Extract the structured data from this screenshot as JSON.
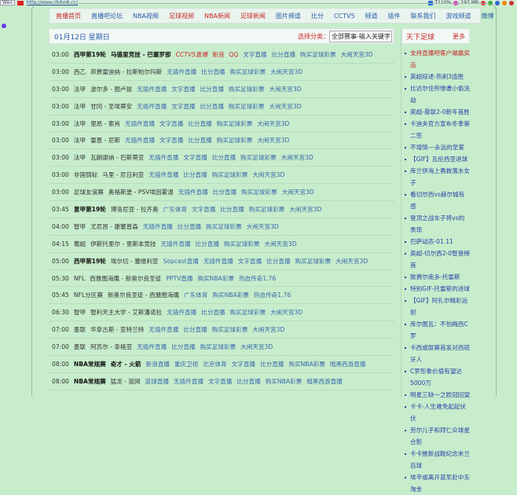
{
  "browser": {
    "favicon_label": "Weo",
    "url": "http://www.zhibo8.cc/",
    "zoom": "T110%",
    "memory": "197 MB"
  },
  "nav": [
    {
      "label": "直播首页",
      "red": true
    },
    {
      "label": "直播吧论坛"
    },
    {
      "label": "NBA视频"
    },
    {
      "label": "足球视频",
      "red": true
    },
    {
      "label": "NBA新闻",
      "red": true
    },
    {
      "label": "足球新闻",
      "red": true
    },
    {
      "label": "图片频道"
    },
    {
      "label": "比分"
    },
    {
      "label": "CCTV5"
    },
    {
      "label": "频道"
    },
    {
      "label": "插件"
    },
    {
      "label": "联系我们"
    },
    {
      "label": "游戏频道"
    },
    {
      "label": "微博"
    }
  ],
  "date_bar": {
    "date": "01月12日 星期日",
    "filter_label": "选择分类：",
    "filter_value": "全部赛事-输入关键字"
  },
  "matches": [
    {
      "time": "03:00",
      "league": "西甲第19轮",
      "bold": true,
      "teams": "马德里竞技 - 巴塞罗那",
      "links": [
        {
          "label": "CCTV5直播",
          "red": true,
          "italic": true
        },
        {
          "label": "新浪",
          "red": true
        },
        {
          "label": "QQ",
          "red": true
        },
        {
          "label": "文字直播"
        },
        {
          "label": "比分直播"
        },
        {
          "label": "购买足球彩票"
        },
        {
          "label": "大闹天宫3D"
        }
      ]
    },
    {
      "time": "03:00",
      "league": "西乙",
      "teams": "邦费雷迪纳 - 拉斯帕尔玛斯",
      "links": [
        {
          "label": "无插件直播"
        },
        {
          "label": "比分直播"
        },
        {
          "label": "购买足球彩票"
        },
        {
          "label": "大闹天宫3D"
        }
      ]
    },
    {
      "time": "03:00",
      "league": "法甲",
      "teams": "波尔多 - 图卢兹",
      "links": [
        {
          "label": "无插件直播"
        },
        {
          "label": "文字直播"
        },
        {
          "label": "比分直播"
        },
        {
          "label": "购买足球彩票"
        },
        {
          "label": "大闹天宫3D"
        }
      ]
    },
    {
      "time": "03:00",
      "league": "法甲",
      "teams": "甘冈 - 圣埃蒂安",
      "links": [
        {
          "label": "无插件直播"
        },
        {
          "label": "文字直播"
        },
        {
          "label": "比分直播"
        },
        {
          "label": "购买足球彩票"
        },
        {
          "label": "大闹天宫3D"
        }
      ]
    },
    {
      "time": "03:00",
      "league": "法甲",
      "teams": "里昂 - 索肖",
      "links": [
        {
          "label": "无插件直播"
        },
        {
          "label": "文字直播"
        },
        {
          "label": "比分直播"
        },
        {
          "label": "购买足球彩票"
        },
        {
          "label": "大闹天宫3D"
        }
      ]
    },
    {
      "time": "03:00",
      "league": "法甲",
      "teams": "雷恩 - 尼斯",
      "links": [
        {
          "label": "无插件直播"
        },
        {
          "label": "文字直播"
        },
        {
          "label": "比分直播"
        },
        {
          "label": "购买足球彩票"
        },
        {
          "label": "大闹天宫3D"
        }
      ]
    },
    {
      "time": "03:00",
      "league": "法甲",
      "teams": "瓦朗谢纳 - 巴斯蒂亚",
      "links": [
        {
          "label": "无插件直播"
        },
        {
          "label": "文字直播"
        },
        {
          "label": "比分直播"
        },
        {
          "label": "购买足球彩票"
        },
        {
          "label": "大闹天宫3D"
        }
      ]
    },
    {
      "time": "03:00",
      "league": "非国锦标",
      "teams": "马里 - 尼日利亚",
      "links": [
        {
          "label": "无插件直播"
        },
        {
          "label": "比分直播"
        },
        {
          "label": "购买足球彩票"
        },
        {
          "label": "大闹天宫3D"
        }
      ]
    },
    {
      "time": "03:00",
      "league": "足球友谊赛",
      "teams": "奥格斯堡 - PSV埃因霍温",
      "links": [
        {
          "label": "无插件直播"
        },
        {
          "label": "比分直播"
        },
        {
          "label": "购买足球彩票"
        },
        {
          "label": "大闹天宫3D"
        }
      ]
    },
    {
      "time": "03:45",
      "league": "意甲第19轮",
      "bold": true,
      "teams": "博洛尼亚 - 拉齐奥",
      "links": [
        {
          "label": "广东体育"
        },
        {
          "label": "文字直播"
        },
        {
          "label": "比分直播"
        },
        {
          "label": "购买足球彩票"
        },
        {
          "label": "大闹天宫3D"
        }
      ]
    },
    {
      "time": "04:00",
      "league": "智甲",
      "teams": "尤尼昂 - 康塞普森",
      "links": [
        {
          "label": "无插件直播"
        },
        {
          "label": "比分直播"
        },
        {
          "label": "购买足球彩票"
        },
        {
          "label": "大闹天宫3D"
        }
      ]
    },
    {
      "time": "04:15",
      "league": "葡超",
      "teams": "伊斯托里尔 - 里斯本竞技",
      "links": [
        {
          "label": "无插件直播"
        },
        {
          "label": "比分直播"
        },
        {
          "label": "购买足球彩票"
        },
        {
          "label": "大闹天宫3D"
        }
      ]
    },
    {
      "time": "05:00",
      "league": "西甲第19轮",
      "bold": true,
      "teams": "埃尔切 - 塞维利亚",
      "links": [
        {
          "label": "Sopcast直播"
        },
        {
          "label": "无插件直播"
        },
        {
          "label": "文字直播"
        },
        {
          "label": "比分直播"
        },
        {
          "label": "购买足球彩票"
        },
        {
          "label": "大闹天宫3D"
        }
      ]
    },
    {
      "time": "05:30",
      "league": "NFL",
      "teams": "西雅图海鹰 - 新奥尔良圣徒",
      "links": [
        {
          "label": "PPTV直播"
        },
        {
          "label": "购买NBA彩票"
        },
        {
          "label": "热血传奇1.76"
        }
      ]
    },
    {
      "time": "05:45",
      "league": "NFL分区赛",
      "teams": "新奥尔良圣徒 - 西雅图海鹰",
      "links": [
        {
          "label": "广东体育"
        },
        {
          "label": "购买NBA彩票"
        },
        {
          "label": "热血传奇1.76"
        }
      ]
    },
    {
      "time": "06:30",
      "league": "智甲",
      "teams": "智利天主大学 - 艾斯潘诺拉",
      "links": [
        {
          "label": "无插件直播"
        },
        {
          "label": "比分直播"
        },
        {
          "label": "购买足球彩票"
        },
        {
          "label": "大闹天宫3D"
        }
      ]
    },
    {
      "time": "07:00",
      "league": "墨联",
      "teams": "华拿古斯 - 亚特兰特",
      "links": [
        {
          "label": "无插件直播"
        },
        {
          "label": "比分直播"
        },
        {
          "label": "购买足球彩票"
        },
        {
          "label": "大闹天宫3D"
        }
      ]
    },
    {
      "time": "07:00",
      "league": "墨联",
      "teams": "阿苏尔 - 拿格亚",
      "links": [
        {
          "label": "无插件直播"
        },
        {
          "label": "比分直播"
        },
        {
          "label": "购买足球彩票"
        },
        {
          "label": "大闹天宫3D"
        }
      ]
    },
    {
      "time": "08:00",
      "league": "NBA常规赛",
      "bold": true,
      "teams": "奇才 - 火箭",
      "teams_bold": true,
      "links": [
        {
          "label": "新浪直播"
        },
        {
          "label": "重庆卫视"
        },
        {
          "label": "北京体育"
        },
        {
          "label": "文字直播"
        },
        {
          "label": "比分直播"
        },
        {
          "label": "购买NBA彩票"
        },
        {
          "label": "暗黑西游直播"
        }
      ]
    },
    {
      "time": "08:00",
      "league": "NBA常规赛",
      "bold": true,
      "teams": "猛龙 - 篮网",
      "links": [
        {
          "label": "篮球直播"
        },
        {
          "label": "无插件直播"
        },
        {
          "label": "文字直播"
        },
        {
          "label": "比分直播"
        },
        {
          "label": "购买NBA彩票"
        },
        {
          "label": "暗黑西游直播"
        }
      ]
    }
  ],
  "sidebar": {
    "title": "天下足球",
    "more": "更多",
    "items": [
      {
        "label": "支持直播吧客户端赢奖品",
        "red": true
      },
      {
        "label": "英超综述-热刺3连胜"
      },
      {
        "label": "比达尔住所惨遭小偷洗劫"
      },
      {
        "label": "英超-曼联2-0新年首胜"
      },
      {
        "label": "卡迪夫官方宣布冬季第二签"
      },
      {
        "label": "不增情---永远的至爱"
      },
      {
        "label": "【GIF】瓦伦西亚进球"
      },
      {
        "label": "库兰伊海上勇救落水女子"
      },
      {
        "label": "看切尔西vs赫尔城有感"
      },
      {
        "label": "登顶之战车子将vs的表现"
      },
      {
        "label": "巴萨动态-01.11"
      },
      {
        "label": "英超-切尔西2-0智登榜首"
      },
      {
        "label": "致费尔南多-托雷斯"
      },
      {
        "label": "特别GIF-托雷斯的进球"
      },
      {
        "label": "【GIF】阿扎尔精彩远射"
      },
      {
        "label": "库尔图瓦：不怕梅西C罗"
      },
      {
        "label": "卡西或联赛首发对西班牙人"
      },
      {
        "label": "C罗形象价值有望达5000万"
      },
      {
        "label": "明星三缺一之欧冠回望"
      },
      {
        "label": "卡卡-人生难免起起伏伏"
      },
      {
        "label": "劳尔儿子和拜仁众球星合影"
      },
      {
        "label": "卡卡推新战靴纪念米兰百球"
      },
      {
        "label": "埃辛或离开蓝军赴中东淘金"
      }
    ]
  }
}
